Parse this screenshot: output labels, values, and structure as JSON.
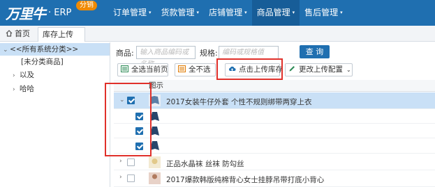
{
  "brand": {
    "name_cn": "万里牛",
    "dot_erp": "· ERP",
    "badge": "分销"
  },
  "nav": {
    "items": [
      {
        "label": "订单管理",
        "caret": "▾"
      },
      {
        "label": "货款管理",
        "caret": "▾"
      },
      {
        "label": "店铺管理",
        "caret": "▾"
      },
      {
        "label": "商品管理",
        "caret": "▾"
      },
      {
        "label": "售后管理",
        "caret": "▾"
      }
    ],
    "active_index": 3
  },
  "tabs": {
    "home": "首页",
    "current": "库存上传",
    "close": "×"
  },
  "sidebar": {
    "root": "<<所有系统分类>>",
    "items": [
      "[未分类商品]",
      "以及",
      "哈哈"
    ]
  },
  "filter": {
    "goods_label": "商品:",
    "goods_placeholder": "输入商品编码或名称",
    "spec_label": "规格:",
    "spec_placeholder": "编码或规格值",
    "query": "查 询"
  },
  "toolbar": {
    "select_page": "全选当前页",
    "select_all": "全不选",
    "upload": "点击上传库存",
    "config": "更改上传配置"
  },
  "grid": {
    "col_image": "图示",
    "rows": [
      {
        "title": "2017女装牛仔外套 个性不规则绑带两穿上衣",
        "checked": true,
        "expanded": true
      },
      {
        "title": "",
        "checked": true
      },
      {
        "title": "",
        "checked": true
      },
      {
        "title": "",
        "checked": true
      },
      {
        "title": "正品水晶袜 丝袜 防勾丝",
        "checked": false,
        "expanded": false
      },
      {
        "title": "2017爆款韩版纯棉背心女士挂脖吊带打底小背心",
        "checked": false,
        "expanded": false
      }
    ]
  },
  "colors": {
    "primary": "#1f6fb0",
    "badge": "#f08a00",
    "highlight": "#c9e0f6",
    "annotation": "#e0302a"
  }
}
